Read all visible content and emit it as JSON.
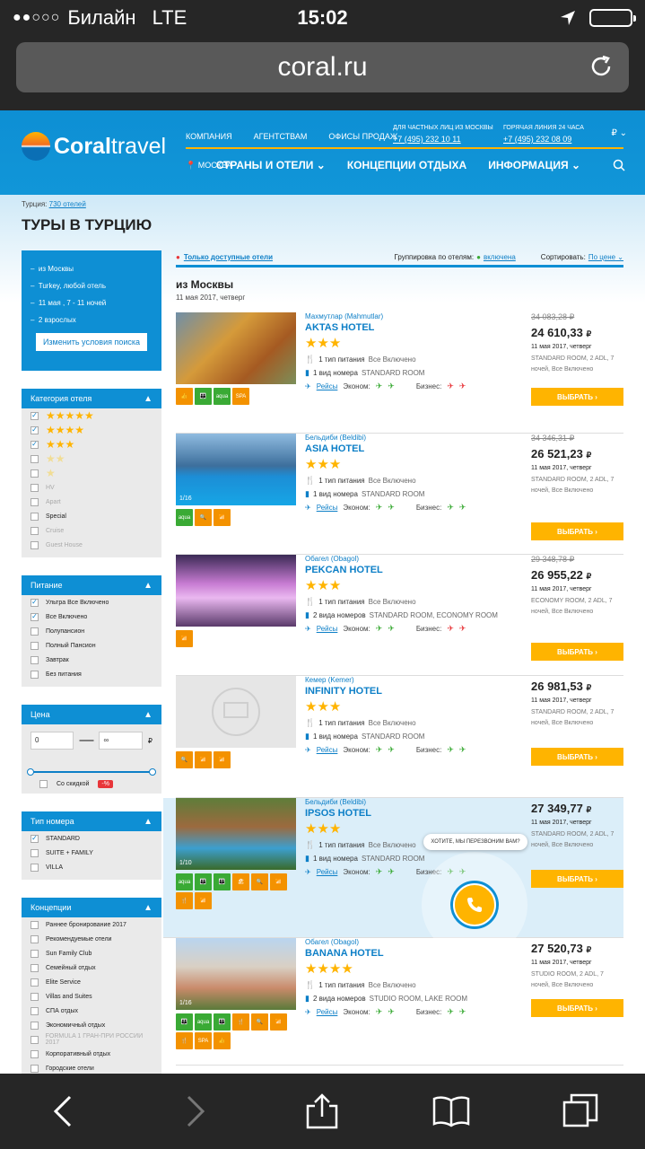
{
  "status": {
    "signal": "●●○○○",
    "carrier": "Билайн",
    "network": "LTE",
    "time": "15:02"
  },
  "browser": {
    "url": "coral.ru"
  },
  "header": {
    "brand_bold": "Coral",
    "brand_light": "travel",
    "nav": [
      "КОМПАНИЯ",
      "АГЕНТСТВАМ",
      "ОФИСЫ ПРОДАЖ"
    ],
    "phone1_label": "ДЛЯ ЧАСТНЫХ ЛИЦ ИЗ МОСКВЫ",
    "phone1": "+7 (495) 232 10 11",
    "phone2_label": "ГОРЯЧАЯ ЛИНИЯ 24 ЧАСА",
    "phone2": "+7 (495) 232 08 09",
    "currency": "₽",
    "city": "МОСКВА",
    "main_nav": [
      "СТРАНЫ И ОТЕЛИ",
      "КОНЦЕПЦИИ ОТДЫХА",
      "ИНФОРМАЦИЯ"
    ]
  },
  "breadcrumb": {
    "prefix": "Турция:",
    "link": "730 отелей"
  },
  "page_title": "ТУРЫ В ТУРЦИЮ",
  "search_box": {
    "rows": [
      "из Москвы",
      "Turkey, любой отель",
      "11 мая , 7 - 11 ночей",
      "2 взрослых"
    ],
    "change_label": "Изменить условия поиска"
  },
  "filters": {
    "category": {
      "title": "Категория отеля",
      "options": [
        {
          "label": "★★★★★",
          "checked": true,
          "dim": false
        },
        {
          "label": "★★★★",
          "checked": true,
          "dim": false
        },
        {
          "label": "★★★",
          "checked": true,
          "dim": false
        },
        {
          "label": "★★",
          "checked": false,
          "dim": true
        },
        {
          "label": "★",
          "checked": false,
          "dim": true
        },
        {
          "label": "HV",
          "checked": false,
          "dim": true
        },
        {
          "label": "Apart",
          "checked": false,
          "dim": true
        },
        {
          "label": "Special",
          "checked": false,
          "dim": false
        },
        {
          "label": "Cruise",
          "checked": false,
          "dim": true
        },
        {
          "label": "Guest House",
          "checked": false,
          "dim": true
        }
      ]
    },
    "meal": {
      "title": "Питание",
      "options": [
        {
          "label": "Ультра Все Включено",
          "checked": true
        },
        {
          "label": "Все Включено",
          "checked": true
        },
        {
          "label": "Полупансион",
          "checked": false
        },
        {
          "label": "Полный Пансион",
          "checked": false
        },
        {
          "label": "Завтрак",
          "checked": false
        },
        {
          "label": "Без питания",
          "checked": false
        }
      ]
    },
    "price": {
      "title": "Цена",
      "from": "0",
      "to": "∞",
      "currency": "₽",
      "discount_label": "Со скидкой",
      "discount_badge": "-%"
    },
    "room": {
      "title": "Тип номера",
      "options": [
        {
          "label": "STANDARD",
          "checked": true
        },
        {
          "label": "SUITE + FAMILY",
          "checked": false
        },
        {
          "label": "VILLA",
          "checked": false
        }
      ]
    },
    "concepts": {
      "title": "Концепции",
      "options": [
        {
          "label": "Раннее бронирование 2017",
          "dim": false
        },
        {
          "label": "Рекомендуемые отели",
          "dim": false
        },
        {
          "label": "Sun Family Club",
          "dim": false
        },
        {
          "label": "Семейный отдых",
          "dim": false
        },
        {
          "label": "Elite Service",
          "dim": false
        },
        {
          "label": "Villas and Suites",
          "dim": false
        },
        {
          "label": "СПА отдых",
          "dim": false
        },
        {
          "label": "Экономичный отдых",
          "dim": false
        },
        {
          "label": "FORMULA 1 ГРАН-ПРИ РОССИИ 2017",
          "dim": true
        },
        {
          "label": "Корпоративный отдых",
          "dim": false
        },
        {
          "label": "Городские отели",
          "dim": false
        }
      ]
    }
  },
  "results_bar": {
    "available": "Только доступные отели",
    "grouping_label": "Группировка по отелям:",
    "grouping_value": "включена",
    "sort_label": "Сортировать:",
    "sort_value": "По цене"
  },
  "departure": {
    "from": "из Москвы",
    "date": "11 мая 2017, четверг"
  },
  "labels": {
    "meal_types": "1 тип питания",
    "flights": "Рейсы",
    "economy": "Эконом:",
    "business": "Бизнес:",
    "pick": "ВЫБРАТЬ",
    "callback": "ХОТИТЕ, МЫ ПЕРЕЗВОНИМ ВАМ?"
  },
  "hotels": [
    {
      "region": "Махмутлар (Mahmutlar)",
      "name": "AKTAS HOTEL",
      "stars": "★★★",
      "meal": "Все Включено",
      "rooms_label": "1 вид номера",
      "rooms": "STANDARD ROOM",
      "old_price": "34 083,28 ₽",
      "price": "24 610,33",
      "date": "11 мая 2017, четверг",
      "room_info": "STANDARD ROOM, 2 ADL, 7 ночей, Все Включено",
      "photo_count": "",
      "icons": [
        "👍",
        "👪",
        "aqua",
        "SPA"
      ]
    },
    {
      "region": "Бельдиби (Beldibi)",
      "name": "ASIA HOTEL",
      "stars": "★★★",
      "meal": "Все Включено",
      "rooms_label": "1 вид номера",
      "rooms": "STANDARD ROOM",
      "old_price": "34 346,31 ₽",
      "price": "26 521,23",
      "date": "11 мая 2017, четверг",
      "room_info": "STANDARD ROOM, 2 ADL, 7 ночей, Все Включено",
      "photo_count": "1/16",
      "icons": [
        "aqua",
        "🔍",
        "📶"
      ]
    },
    {
      "region": "Обагел (Obagol)",
      "name": "PEKCAN HOTEL",
      "stars": "★★★",
      "meal": "Все Включено",
      "rooms_label": "2 вида номеров",
      "rooms": "STANDARD ROOM, ECONOMY ROOM",
      "old_price": "29 348,78 ₽",
      "price": "26 955,22",
      "date": "11 мая 2017, четверг",
      "room_info": "ECONOMY ROOM, 2 ADL, 7 ночей, Все Включено",
      "photo_count": "",
      "icons": [
        "📶"
      ]
    },
    {
      "region": "Кемер (Kemer)",
      "name": "INFINITY HOTEL",
      "stars": "★★★",
      "meal": "Все Включено",
      "rooms_label": "1 вид номера",
      "rooms": "STANDARD ROOM",
      "old_price": "",
      "price": "26 981,53",
      "date": "11 мая 2017, четверг",
      "room_info": "STANDARD ROOM, 2 ADL, 7 ночей, Все Включено",
      "photo_count": "",
      "icons": [
        "🔍",
        "📶",
        "📶"
      ]
    },
    {
      "region": "Бельдиби (Beldibi)",
      "name": "IPSOS HOTEL",
      "stars": "★★★",
      "meal": "Все Включено",
      "rooms_label": "1 вид номера",
      "rooms": "STANDARD ROOM",
      "old_price": "",
      "price": "27 349,77",
      "date": "11 мая 2017, четверг",
      "room_info": "STANDARD ROOM, 2 ADL, 7 ночей, Все Включено",
      "photo_count": "1/10",
      "icons": [
        "aqua",
        "👪",
        "👪",
        "🏖",
        "🔍",
        "📶",
        "🍴",
        "📶"
      ]
    },
    {
      "region": "Обагел (Obagol)",
      "name": "BANANA HOTEL",
      "stars": "★★★★",
      "meal": "Все Включено",
      "rooms_label": "2 вида номеров",
      "rooms": "STUDIO ROOM, LAKE ROOM",
      "old_price": "",
      "price": "27 520,73",
      "date": "11 мая 2017, четверг",
      "room_info": "STUDIO ROOM, 2 ADL, 7 ночей, Все Включено",
      "photo_count": "1/16",
      "icons": [
        "👪",
        "aqua",
        "👪",
        "🍴",
        "🔍",
        "📶",
        "🍴",
        "SPA",
        "👍"
      ]
    }
  ],
  "colors": {
    "brand_blue": "#0e8fd4",
    "accent": "#ffb400",
    "link": "#0d7fc7"
  }
}
